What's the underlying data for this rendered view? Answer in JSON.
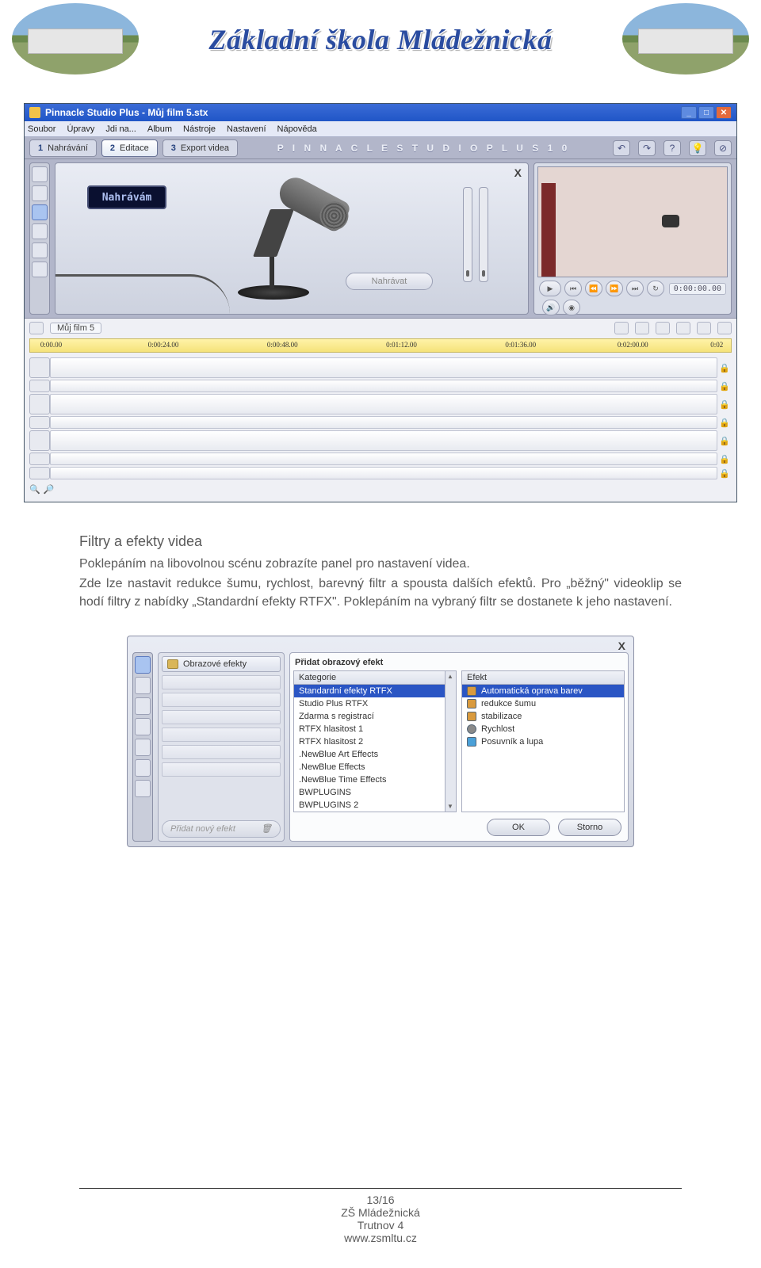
{
  "header": {
    "title": "Základní škola Mládežnická"
  },
  "screenshot1": {
    "window_title": "Pinnacle Studio Plus - Můj film 5.stx",
    "menu": [
      "Soubor",
      "Úpravy",
      "Jdi na...",
      "Album",
      "Nástroje",
      "Nastavení",
      "Nápověda"
    ],
    "tabs": [
      {
        "num": "1",
        "label": "Nahrávání"
      },
      {
        "num": "2",
        "label": "Editace"
      },
      {
        "num": "3",
        "label": "Export videa"
      }
    ],
    "brand": "P I N N A C L E   S T U D I O   P L U S   1 0",
    "help_glyphs": [
      "↶",
      "↷",
      "?",
      "💡",
      "⊘"
    ],
    "rec_display": "Nahrávám",
    "rec_button": "Nahrávat",
    "close_x": "X",
    "timecode": "0:00:00.00",
    "project_name": "Můj film 5",
    "ruler_marks": [
      "0:00.00",
      "0:00:24.00",
      "0:00:48.00",
      "0:01:12.00",
      "0:01:36.00",
      "0:02:00.00",
      "0:02"
    ]
  },
  "text": {
    "heading": "Filtry a efekty videa",
    "p1": "Poklepáním na libovolnou scénu zobrazíte panel pro nastavení videa.",
    "p2": "Zde lze nastavit redukce šumu, rychlost, barevný filtr a spousta dalších efektů. Pro „běžný\" videoklip se hodí filtry z nabídky „Standardní efekty RTFX\". Poklepáním na vybraný filtr se dostanete k jeho nastavení."
  },
  "screenshot2": {
    "close_x": "X",
    "folder_label": "Obrazové efekty",
    "add_new": "Přidat nový efekt",
    "panel_title": "Přidat obrazový efekt",
    "col1_head": "Kategorie",
    "col2_head": "Efekt",
    "categories": [
      "Standardní efekty RTFX",
      "Studio Plus RTFX",
      "Zdarma s registrací",
      "RTFX hlasitost 1",
      "RTFX hlasitost 2",
      ".NewBlue Art Effects",
      ".NewBlue Effects",
      ".NewBlue Time Effects",
      "BWPLUGINS",
      "BWPLUGINS 2"
    ],
    "effects": [
      "Automatická oprava barev",
      "redukce šumu",
      "stabilizace",
      "Rychlost",
      "Posuvník a lupa"
    ],
    "ok": "OK",
    "cancel": "Storno"
  },
  "footer": {
    "page": "13/16",
    "line1": "ZŠ Mládežnická",
    "line2": "Trutnov 4",
    "line3": "www.zsmltu.cz"
  }
}
